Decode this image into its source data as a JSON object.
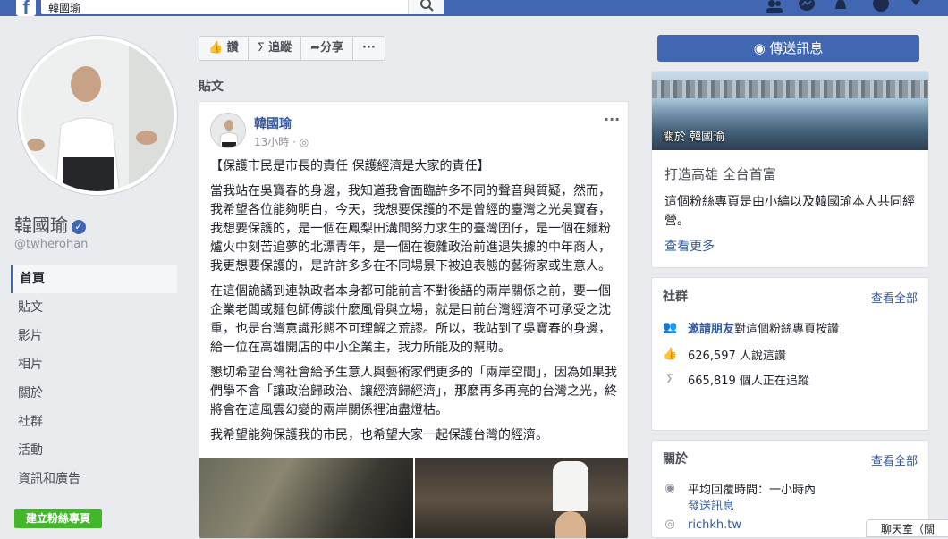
{
  "topbar": {
    "logo": "f",
    "search_value": "韓國瑜"
  },
  "sidebar": {
    "page_name": "韓國瑜",
    "handle": "@twherohan",
    "items": [
      {
        "label": "首頁",
        "active": true
      },
      {
        "label": "貼文"
      },
      {
        "label": "影片"
      },
      {
        "label": "相片"
      },
      {
        "label": "關於"
      },
      {
        "label": "社群"
      },
      {
        "label": "活動"
      },
      {
        "label": "資訊和廣告"
      }
    ],
    "create_label": "建立粉絲專頁"
  },
  "actions": {
    "like": "讚",
    "follow": "追蹤",
    "share": "分享",
    "more": "···"
  },
  "posts_label": "貼文",
  "post": {
    "author": "韓國瑜",
    "time": "13小時 · ",
    "more": "···",
    "paragraphs": [
      "【保護市民是市長的責任 保護經濟是大家的責任】",
      "當我站在吳寶春的身邊，我知道我會面臨許多不同的聲音與質疑，然而，我希望各位能夠明白，今天，我想要保護的不是曾經的臺灣之光吳寶春，我想要保護的，是一個在鳳梨田溝間努力求生的臺灣囝仔，是一個在麵粉爐火中刻苦追夢的北漂青年，是一個在複雜政治前進退失據的中年商人，我更想要保護的，是許許多多在不同場景下被迫表態的藝術家或生意人。",
      "在這個詭譎到連執政者本身都可能前言不對後語的兩岸關係之前，要一個企業老闆或麵包師傅談什麼風骨與立場，就是目前台灣經濟不可承受之沈重，也是台灣意識形態不可理解之荒謬。所以，我站到了吳寶春的身邊，給一位在高雄開店的中小企業主，我力所能及的幫助。",
      "懇切希望台灣社會給予生意人與藝術家們更多的「兩岸空間」，因為如果我們學不會「讓政治歸政治、讓經濟歸經濟」，那麼再多再亮的台灣之光，終將會在這風雲幻變的兩岸關係裡油盡燈枯。",
      "我希望能夠保護我的市民，也希望大家一起保護台灣的經濟。"
    ]
  },
  "right": {
    "message_button": "傳送訊息",
    "cover_label": "關於 韓國瑜",
    "about_title": "打造高雄 全台首富",
    "about_desc": "這個粉絲專頁是由小編以及韓國瑜本人共同經營。",
    "about_more": "查看更多",
    "community": {
      "title": "社群",
      "see_all": "查看全部",
      "invite_link": "邀請朋友",
      "invite_text": " 對這個粉絲專頁按讚",
      "likes": "626,597 人說這讚",
      "follows": "665,819 個人正在追蹤"
    },
    "about": {
      "title": "關於",
      "see_all": "查看全部",
      "response": "平均回覆時間：一小時內",
      "send_message": "發送訊息",
      "website": "richkh.tw"
    },
    "popup_text": "聊天室（關"
  },
  "colors": {
    "brand": "#4267b2",
    "link": "#365899",
    "green": "#42b72a"
  }
}
